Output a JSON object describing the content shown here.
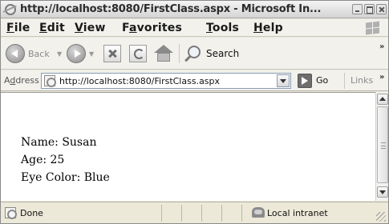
{
  "window": {
    "title": "http://localhost:8080/FirstClass.aspx - Microsoft In..."
  },
  "menu": {
    "file": {
      "u": "F",
      "rest": "ile"
    },
    "edit": {
      "u": "E",
      "rest": "dit"
    },
    "view": {
      "u": "V",
      "rest": "iew"
    },
    "favorites": {
      "pre": "F",
      "u": "a",
      "rest": "vorites"
    },
    "tools": {
      "u": "T",
      "rest": "ools"
    },
    "help": {
      "u": "H",
      "rest": "elp"
    }
  },
  "toolbar": {
    "back_label": "Back",
    "search_label": "Search",
    "overflow": "»"
  },
  "address": {
    "label_pre": "A",
    "label_u": "d",
    "label_rest": "dress",
    "url": "http://localhost:8080/FirstClass.aspx",
    "go_label": "Go",
    "links_label": "Links",
    "overflow": "»"
  },
  "content": {
    "lines": [
      "Name: Susan",
      "Age: 25",
      "Eye Color: Blue"
    ]
  },
  "status": {
    "text": "Done",
    "zone": "Local intranet"
  }
}
